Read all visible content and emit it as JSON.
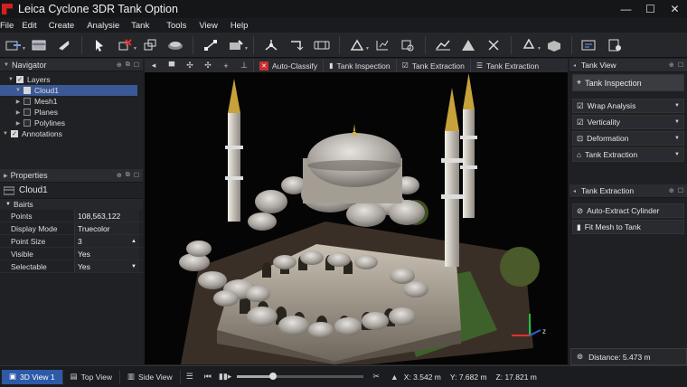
{
  "app": {
    "title": "Leica Cyclone 3DR Tank Option"
  },
  "window": {
    "minimize": "—",
    "maximize": "☐",
    "close": "✕"
  },
  "menu": [
    "File",
    "Edit",
    "Create",
    "Analysie",
    "Tank",
    "Tools",
    "View",
    "Help"
  ],
  "toolbar": {
    "icons": [
      "import-icon",
      "layers-icon",
      "link-icon",
      "select-icon",
      "clip-icon",
      "transform-icon",
      "scan-icon",
      "register-icon",
      "measure-icon",
      "mesh-icon",
      "fit-icon",
      "section-icon",
      "align-icon",
      "analysis-icon",
      "inspect-icon",
      "compare-icon",
      "volume-icon",
      "deform-icon",
      "surface-icon",
      "recycle-icon",
      "package-icon",
      "report-icon",
      "new-icon"
    ]
  },
  "navigator": {
    "title": "Navigator",
    "items": [
      {
        "label": "Layers",
        "level": 0,
        "checked": true,
        "arrow": "▼"
      },
      {
        "label": "Cloud1",
        "level": 1,
        "checked": true,
        "arrow": "▼",
        "selected": true
      },
      {
        "label": "Mesh1",
        "level": 1,
        "checked": false,
        "arrow": "▶"
      },
      {
        "label": "Planes",
        "level": 1,
        "checked": false,
        "arrow": "▶"
      },
      {
        "label": "Polylines",
        "level": 1,
        "checked": false,
        "arrow": "▶"
      },
      {
        "label": "Annotations",
        "level": 0,
        "checked": true,
        "arrow": "▼"
      }
    ]
  },
  "properties": {
    "title": "Properties",
    "object": "Cloud1",
    "section": "Bairts",
    "rows": [
      {
        "key": "Points",
        "value": "108,563,122",
        "ctl": ""
      },
      {
        "key": "Display Mode",
        "value": "Truecolor",
        "ctl": ""
      },
      {
        "key": "Point Size",
        "value": "3",
        "ctl": "▲"
      },
      {
        "key": "Visible",
        "value": "Yes",
        "ctl": ""
      },
      {
        "key": "Selectable",
        "value": "Yes",
        "ctl": "▼"
      }
    ]
  },
  "viewport_toolbar": {
    "tabs": [
      "Auto-Classify",
      "Tank Inspection",
      "Tank Extraction",
      "Tank Extraction"
    ]
  },
  "tank_view": {
    "title": "Tank View",
    "main_button": "Tank Inspection",
    "items": [
      "Wrap Analysis",
      "Verticality",
      "Deformation",
      "Tank Extraction"
    ]
  },
  "tank_extraction": {
    "title": "Tank Extraction",
    "items": [
      "Auto-Extract Cylinder",
      "Fit Mesh to Tank"
    ]
  },
  "distance": {
    "label": "Distance: 5.473 m"
  },
  "status": {
    "views": [
      "3D View 1",
      "Top View",
      "Side View"
    ],
    "timeline_progress": 0.28,
    "coords": {
      "x": "X: 3.542  m",
      "y": "Y: 7.682 m",
      "z": "Z: 17.821 m"
    }
  },
  "colors": {
    "accent": "#2c5aa8",
    "selection": "#3b5a95",
    "logo": "#d42020"
  }
}
